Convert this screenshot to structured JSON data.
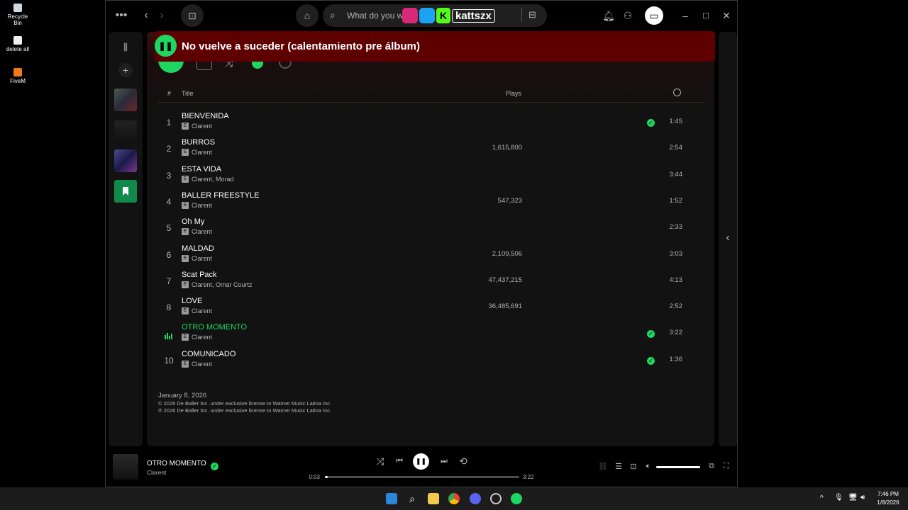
{
  "desktop": {
    "icons": [
      {
        "label": "Recycle Bin"
      },
      {
        "label": "delete all"
      },
      {
        "label": "FiveM"
      }
    ]
  },
  "topbar": {
    "search_placeholder": "What do you wa",
    "overlay_handle": "kattszx"
  },
  "banner": {
    "title": "No vuelve a suceder (calentamiento pre álbum)"
  },
  "tracklist": {
    "header": {
      "num": "#",
      "title": "Title",
      "plays": "Plays"
    },
    "tracks": [
      {
        "num": "1",
        "title": "BIENVENIDA",
        "artists": "Clarent",
        "plays": "",
        "saved": true,
        "duration": "1:45"
      },
      {
        "num": "2",
        "title": "BURROS",
        "artists": "Clarent",
        "plays": "1,615,800",
        "saved": false,
        "duration": "2:54"
      },
      {
        "num": "3",
        "title": "ESTA VIDA",
        "artists": "Clarent, Morad",
        "plays": "",
        "saved": false,
        "duration": "3:44"
      },
      {
        "num": "4",
        "title": "BALLER FREESTYLE",
        "artists": "Clarent",
        "plays": "547,323",
        "saved": false,
        "duration": "1:52"
      },
      {
        "num": "5",
        "title": "Oh My",
        "artists": "Clarent",
        "plays": "",
        "saved": false,
        "duration": "2:33"
      },
      {
        "num": "6",
        "title": "MALDAD",
        "artists": "Clarent",
        "plays": "2,109,506",
        "saved": false,
        "duration": "3:03"
      },
      {
        "num": "7",
        "title": "Scat Pack",
        "artists": "Clarent, Omar Courtz",
        "plays": "47,437,215",
        "saved": false,
        "duration": "4:13"
      },
      {
        "num": "8",
        "title": "LOVE",
        "artists": "Clarent",
        "plays": "36,485,691",
        "saved": false,
        "duration": "2:52"
      },
      {
        "num": "",
        "title": "OTRO MOMENTO",
        "artists": "Clarent",
        "plays": "",
        "saved": true,
        "duration": "3:22",
        "playing": true
      },
      {
        "num": "10",
        "title": "COMUNICADO",
        "artists": "Clarent",
        "plays": "",
        "saved": true,
        "duration": "1:36"
      }
    ]
  },
  "footer": {
    "release_date": "January 8, 2026",
    "copyright_c": "© 2026 De Baller Inc. under exclusive license to Warner Music Latina Inc.",
    "copyright_p": "℗ 2026 De Baller Inc. under exclusive license to Warner Music Latina Inc."
  },
  "now_playing": {
    "title": "OTRO MOMENTO",
    "artist": "Clarent",
    "elapsed": "0:03",
    "total": "3:22",
    "progress_fraction": 0.015,
    "volume_fraction": 1.0
  },
  "taskbar": {
    "time": "7:46 PM",
    "date": "1/8/2026"
  },
  "colors": {
    "accent": "#1ed760",
    "banner": "#5e0000",
    "background": "#121212"
  },
  "icons": [
    "menu-dots-icon",
    "back-icon",
    "forward-icon",
    "cart-icon",
    "home-icon",
    "search-icon",
    "browse-icon",
    "bell-icon",
    "friends-icon",
    "connect-icon",
    "minimize-icon",
    "maximize-icon",
    "close-icon",
    "library-icon",
    "plus-icon",
    "bookmark-icon",
    "clock-icon",
    "check-icon",
    "shuffle-icon",
    "prev-icon",
    "pause-icon",
    "next-icon",
    "repeat-icon",
    "volume-icon",
    "fullscreen-icon"
  ]
}
